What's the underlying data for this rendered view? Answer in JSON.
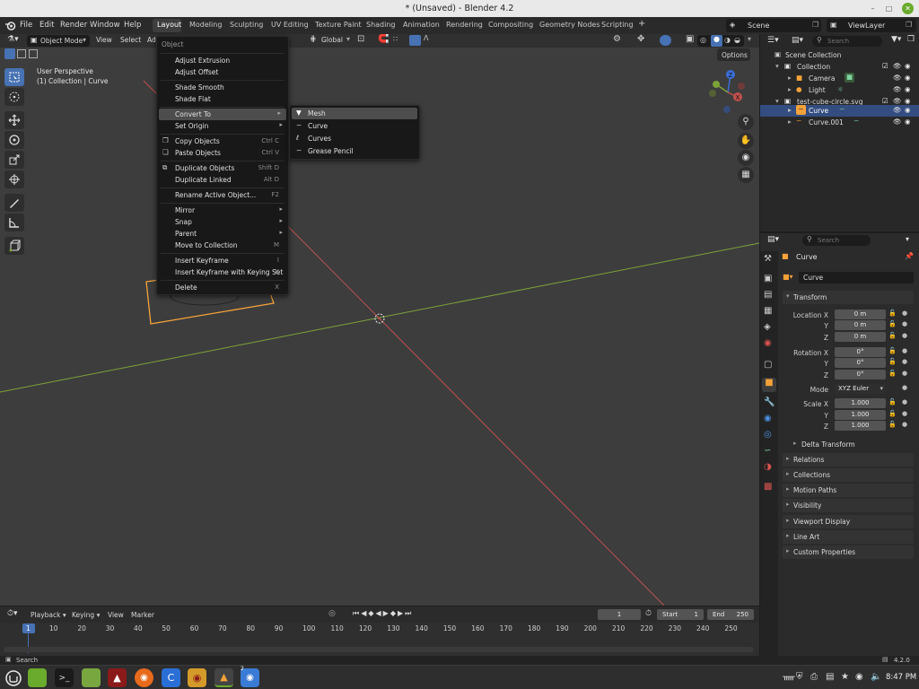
{
  "window": {
    "title": "* (Unsaved) - Blender 4.2"
  },
  "menubar": {
    "menus": [
      "File",
      "Edit",
      "Render",
      "Window",
      "Help"
    ],
    "workspaces": [
      "Layout",
      "Modeling",
      "Sculpting",
      "UV Editing",
      "Texture Paint",
      "Shading",
      "Animation",
      "Rendering",
      "Compositing",
      "Geometry Nodes",
      "Scripting"
    ],
    "add_tab": "+",
    "scene": "Scene",
    "view_layer": "ViewLayer"
  },
  "viewport_header": {
    "mode": "Object Mode",
    "view": "View",
    "select": "Select",
    "add_partial": "Ad",
    "orientation": "Global",
    "options": "Options"
  },
  "viewport": {
    "perspective": "User Perspective",
    "context": "(1) Collection | Curve"
  },
  "object_menu": {
    "title": "Object",
    "items": [
      {
        "label": "Adjust Extrusion",
        "shortcut": ""
      },
      {
        "label": "Adjust Offset",
        "shortcut": ""
      },
      {
        "label": "Shade Smooth",
        "shortcut": ""
      },
      {
        "label": "Shade Flat",
        "shortcut": ""
      },
      {
        "label": "Convert To",
        "shortcut": ""
      },
      {
        "label": "Set Origin",
        "shortcut": ""
      },
      {
        "label": "Copy Objects",
        "shortcut": "Ctrl C"
      },
      {
        "label": "Paste Objects",
        "shortcut": "Ctrl V"
      },
      {
        "label": "Duplicate Objects",
        "shortcut": "Shift D"
      },
      {
        "label": "Duplicate Linked",
        "shortcut": "Alt D"
      },
      {
        "label": "Rename Active Object...",
        "shortcut": "F2"
      },
      {
        "label": "Mirror",
        "shortcut": ""
      },
      {
        "label": "Snap",
        "shortcut": ""
      },
      {
        "label": "Parent",
        "shortcut": ""
      },
      {
        "label": "Move to Collection",
        "shortcut": "M"
      },
      {
        "label": "Insert Keyframe",
        "shortcut": "I"
      },
      {
        "label": "Insert Keyframe with Keying Set",
        "shortcut": "K"
      },
      {
        "label": "Delete",
        "shortcut": "X"
      }
    ]
  },
  "convert_submenu": {
    "items": [
      "Mesh",
      "Curve",
      "Curves",
      "Grease Pencil"
    ]
  },
  "outliner": {
    "search_placeholder": "Search",
    "rows": [
      {
        "label": "Scene Collection"
      },
      {
        "label": "Collection"
      },
      {
        "label": "Camera"
      },
      {
        "label": "Light"
      },
      {
        "label": "test-cube-circle.svg"
      },
      {
        "label": "Curve"
      },
      {
        "label": "Curve.001"
      }
    ]
  },
  "properties": {
    "search_placeholder": "Search",
    "object_name": "Curve",
    "datablock_name": "Curve",
    "transform_label": "Transform",
    "location_label": "Location X",
    "rotation_label": "Rotation X",
    "scale_label": "Scale X",
    "axis_y": "Y",
    "axis_z": "Z",
    "location": [
      "0 m",
      "0 m",
      "0 m"
    ],
    "rotation": [
      "0°",
      "0°",
      "0°"
    ],
    "mode_label": "Mode",
    "mode_value": "XYZ Euler",
    "scale": [
      "1.000",
      "1.000",
      "1.000"
    ],
    "delta_transform": "Delta Transform",
    "panels": [
      "Relations",
      "Collections",
      "Motion Paths",
      "Visibility",
      "Viewport Display",
      "Line Art",
      "Custom Properties"
    ]
  },
  "timeline": {
    "playback": "Playback",
    "keying": "Keying",
    "view": "View",
    "marker": "Marker",
    "current_frame": "1",
    "start_label": "Start",
    "start": "1",
    "end_label": "End",
    "end": "250",
    "ticks": [
      "1",
      "10",
      "20",
      "30",
      "40",
      "50",
      "60",
      "70",
      "80",
      "90",
      "100",
      "110",
      "120",
      "130",
      "140",
      "150",
      "160",
      "170",
      "180",
      "190",
      "200",
      "210",
      "220",
      "230",
      "240",
      "250"
    ]
  },
  "statusbar": {
    "search": "Search",
    "version": "4.2.0"
  },
  "taskbar": {
    "clock": "8:47 PM",
    "badge": "2"
  },
  "colors": {
    "accent_blue": "#4772b3",
    "selection_orange": "#f5a23a",
    "x_axis": "#c0504d",
    "y_axis": "#7ca33a",
    "z_axis": "#3b6fd8"
  }
}
